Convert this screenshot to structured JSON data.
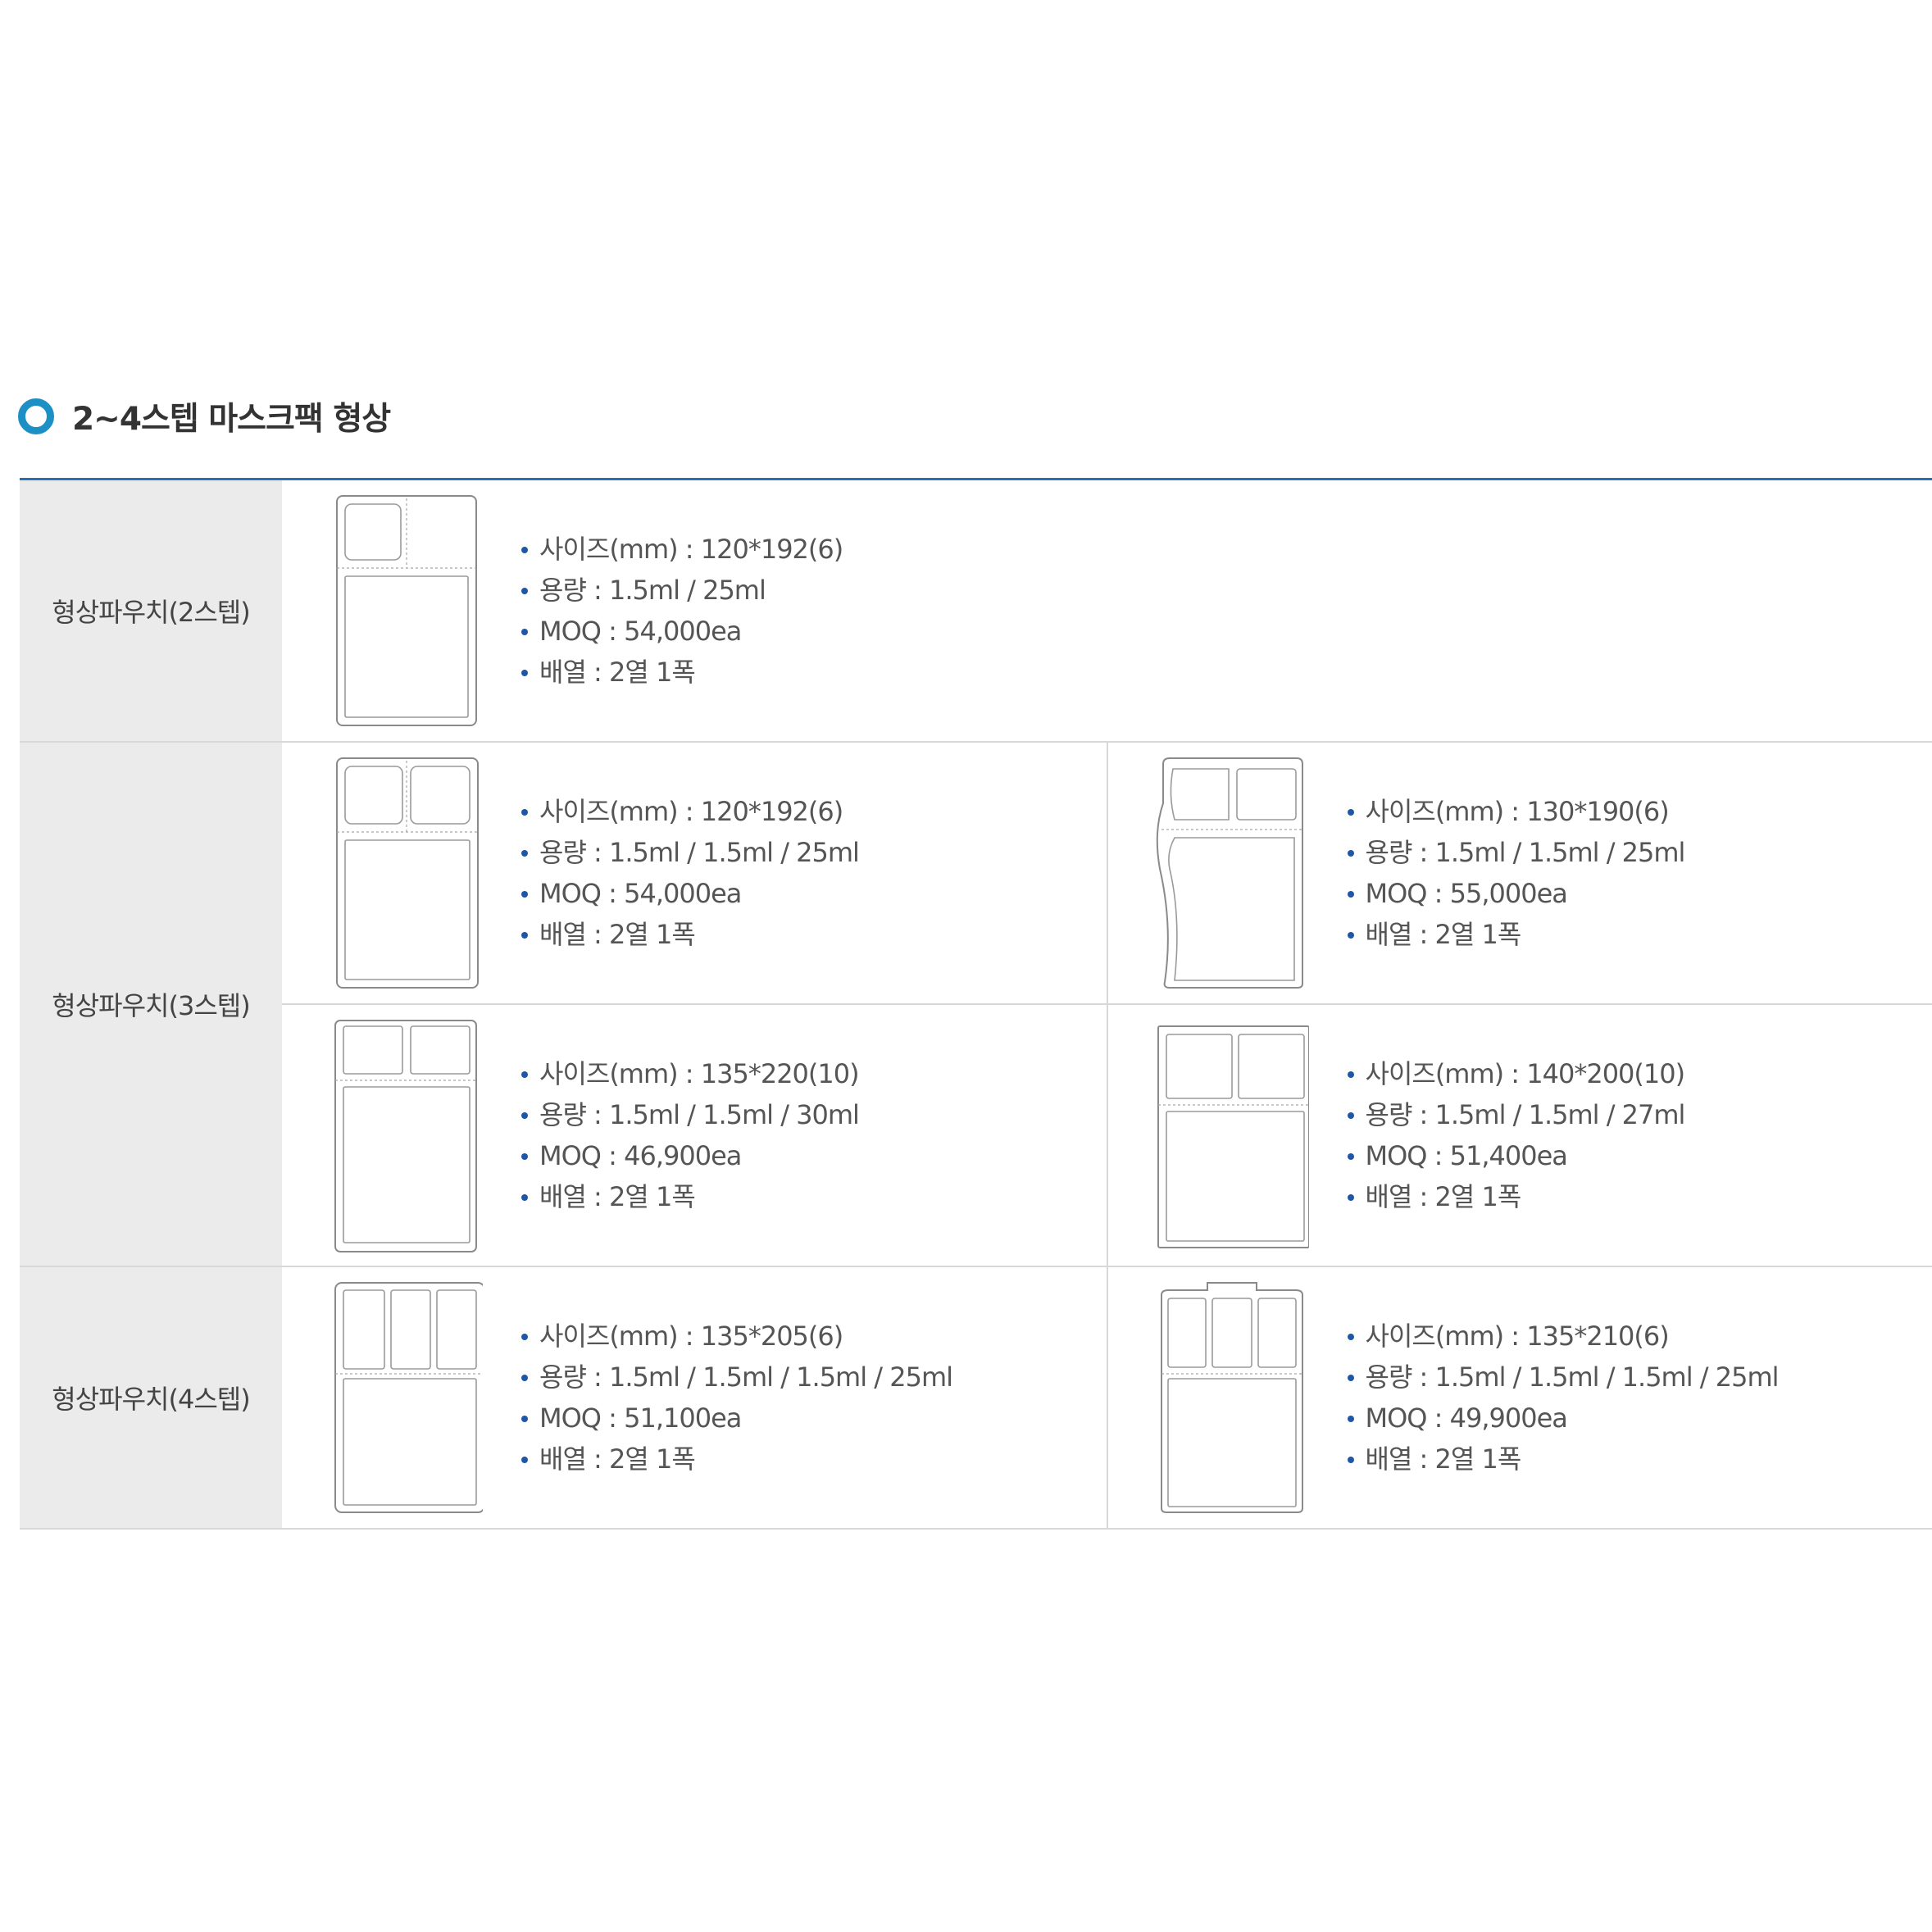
{
  "section": {
    "title": "2~4스텝 마스크팩 형상",
    "accent_color": "#1c8fc4",
    "rule_color": "#2d6fb5"
  },
  "rows": [
    {
      "category": "형상파우치(2스텝)",
      "items": [
        {
          "size": "사이즈(mm) : 120*192(6)",
          "volume": "용량 : 1.5ml / 25ml",
          "moq": "MOQ : 54,000ea",
          "layout": "배열 : 2열 1폭"
        }
      ]
    },
    {
      "category": "형상파우치(3스텝)",
      "items": [
        {
          "size": "사이즈(mm) : 120*192(6)",
          "volume": "용량 : 1.5ml / 1.5ml / 25ml",
          "moq": "MOQ : 54,000ea",
          "layout": "배열 : 2열 1폭"
        },
        {
          "size": "사이즈(mm) : 130*190(6)",
          "volume": "용량 : 1.5ml / 1.5ml / 25ml",
          "moq": "MOQ : 55,000ea",
          "layout": "배열 : 2열 1폭"
        },
        {
          "size": "사이즈(mm) : 135*220(10)",
          "volume": "용량 : 1.5ml / 1.5ml / 30ml",
          "moq": "MOQ : 46,900ea",
          "layout": "배열 : 2열 1폭"
        },
        {
          "size": "사이즈(mm) : 140*200(10)",
          "volume": "용량 : 1.5ml / 1.5ml / 27ml",
          "moq": "MOQ : 51,400ea",
          "layout": "배열 : 2열 1폭"
        }
      ]
    },
    {
      "category": "형상파우치(4스텝)",
      "items": [
        {
          "size": "사이즈(mm) : 135*205(6)",
          "volume": "용량 : 1.5ml / 1.5ml / 1.5ml / 25ml",
          "moq": "MOQ : 51,100ea",
          "layout": "배열 : 2열 1폭"
        },
        {
          "size": "사이즈(mm) : 135*210(6)",
          "volume": "용량 : 1.5ml / 1.5ml / 1.5ml / 25ml",
          "moq": "MOQ : 49,900ea",
          "layout": "배열 : 2열 1폭"
        }
      ]
    }
  ]
}
